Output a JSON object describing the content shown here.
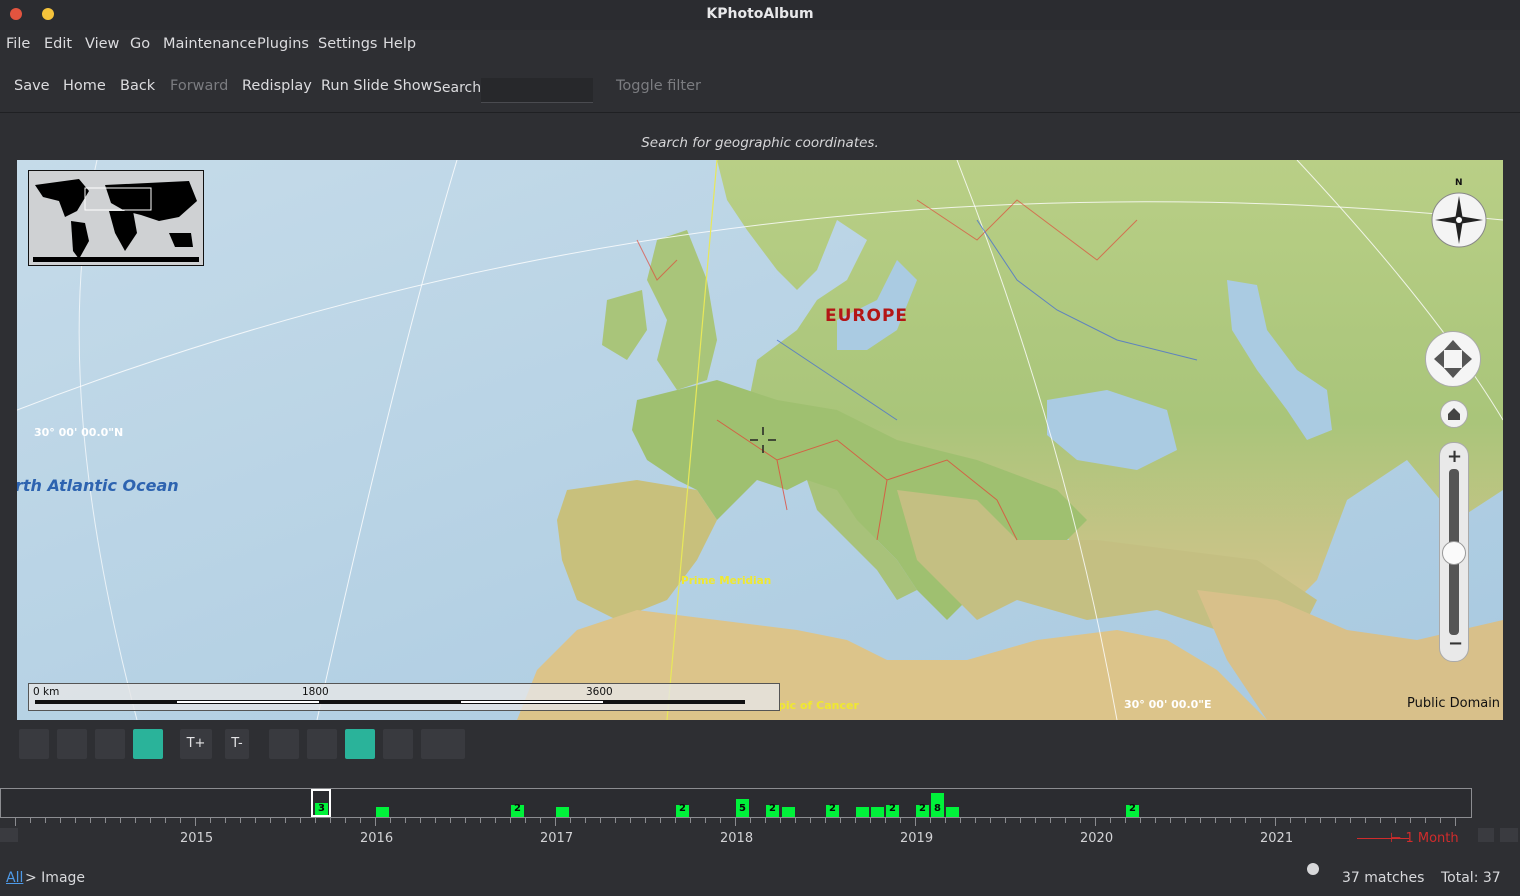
{
  "window": {
    "title": "KPhotoAlbum"
  },
  "menu": [
    "File",
    "Edit",
    "View",
    "Go",
    "Maintenance",
    "Plugins",
    "Settings",
    "Help"
  ],
  "toolbar": {
    "save": "Save",
    "home": "Home",
    "back": "Back",
    "forward": "Forward",
    "redisplay": "Redisplay",
    "slideshow": "Run Slide Show",
    "search_label": "Search:",
    "search_value": "",
    "toggle_filter": "Toggle filter"
  },
  "map": {
    "hint": "Search for geographic coordinates.",
    "labels": {
      "europe": "EUROPE",
      "ocean": "rth Atlantic Ocean",
      "lat": "30° 00' 00.0\"N",
      "lon": "30° 00' 00.0\"E",
      "meridian": "Prime Meridian",
      "cancer": "pic of Cancer",
      "compass_n": "N",
      "attribution": "Public Domain"
    },
    "scale": {
      "start": "0 km",
      "mid": "1800",
      "end": "3600"
    }
  },
  "map_toolbar": {
    "t_plus": "T+",
    "t_minus": "T-"
  },
  "timeline": {
    "years": [
      "2015",
      "2016",
      "2017",
      "2018",
      "2019",
      "2020",
      "2021"
    ],
    "unit": "1 Month",
    "bars": [
      {
        "label": "3",
        "count": 3
      },
      {
        "label": "",
        "count": 1
      },
      {
        "label": "2",
        "count": 2
      },
      {
        "label": "",
        "count": 1
      },
      {
        "label": "2",
        "count": 2
      },
      {
        "label": "5",
        "count": 5
      },
      {
        "label": "2",
        "count": 2
      },
      {
        "label": "",
        "count": 1
      },
      {
        "label": "2",
        "count": 2
      },
      {
        "label": "",
        "count": 1
      },
      {
        "label": "",
        "count": 1
      },
      {
        "label": "2",
        "count": 2
      },
      {
        "label": "2",
        "count": 2
      },
      {
        "label": "8",
        "count": 8
      },
      {
        "label": "",
        "count": 1
      },
      {
        "label": "2",
        "count": 2
      }
    ]
  },
  "status": {
    "breadcrumb_root": "All",
    "breadcrumb_rest": "> Image",
    "matches": "37 matches",
    "total": "Total: 37"
  },
  "colors": {
    "accent": "#2ab39a",
    "bar": "#00f23a",
    "close": "#e2543f",
    "minimize": "#f5c33b"
  }
}
